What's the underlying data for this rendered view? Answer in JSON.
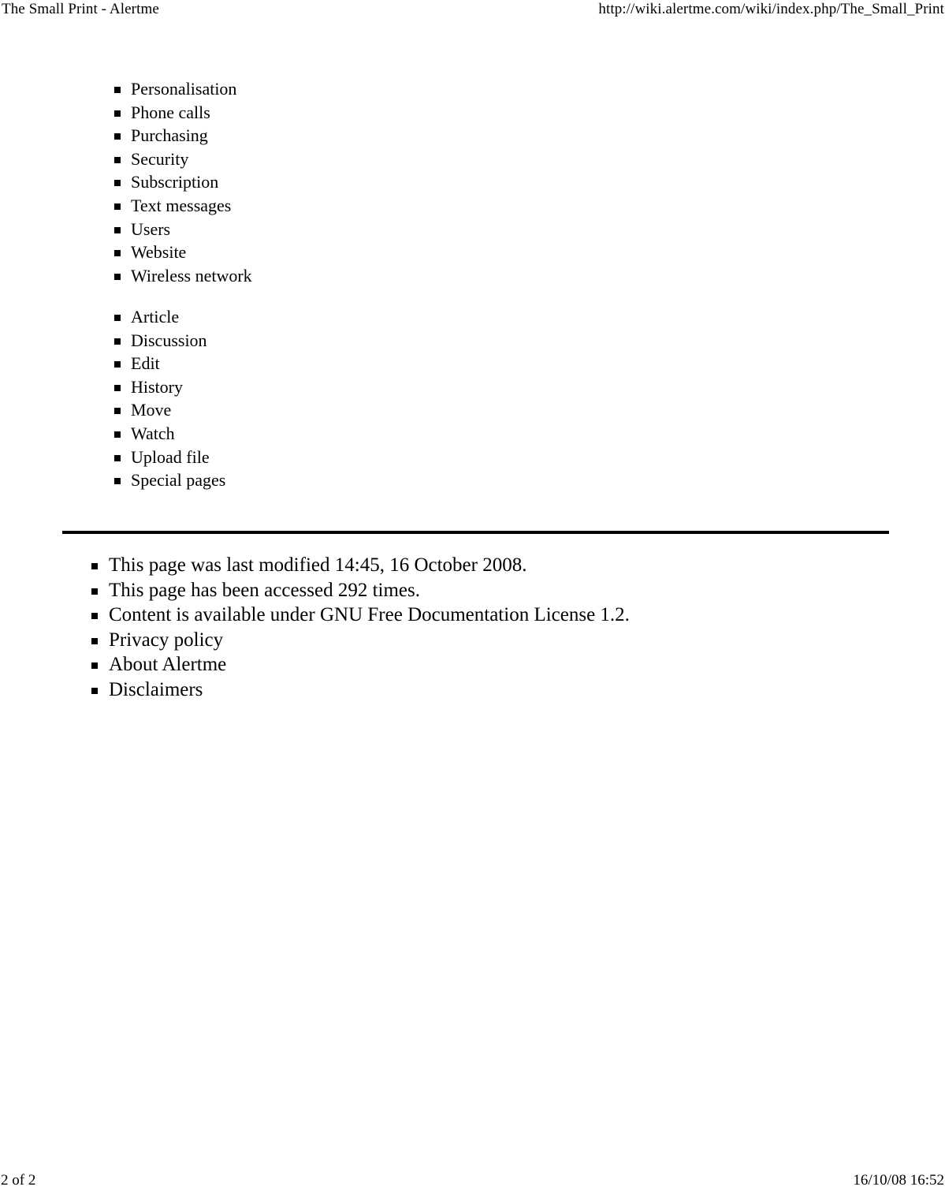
{
  "page_header": {
    "title": "The Small Print - Alertme",
    "url": "http://wiki.alertme.com/wiki/index.php/The_Small_Print"
  },
  "nav_groups": [
    {
      "group_name": "category-links",
      "items": [
        {
          "label": "Personalisation"
        },
        {
          "label": "Phone calls"
        },
        {
          "label": "Purchasing"
        },
        {
          "label": "Security"
        },
        {
          "label": "Subscription"
        },
        {
          "label": "Text messages"
        },
        {
          "label": "Users"
        },
        {
          "label": "Website"
        },
        {
          "label": "Wireless network"
        }
      ]
    },
    {
      "group_name": "page-action-links",
      "items": [
        {
          "label": "Article"
        },
        {
          "label": "Discussion"
        },
        {
          "label": "Edit"
        },
        {
          "label": "History"
        },
        {
          "label": "Move"
        },
        {
          "label": "Watch"
        },
        {
          "label": "Upload file"
        },
        {
          "label": "Special pages"
        }
      ]
    }
  ],
  "wiki_footer": {
    "items": [
      {
        "label": "This page was last modified 14:45, 16 October 2008."
      },
      {
        "label": "This page has been accessed 292 times."
      },
      {
        "label": "Content is available under GNU Free Documentation License 1.2."
      },
      {
        "label": "Privacy policy"
      },
      {
        "label": "About Alertme"
      },
      {
        "label": "Disclaimers"
      }
    ]
  },
  "page_footer": {
    "page_indicator": "2 of 2",
    "timestamp": "16/10/08 16:52"
  },
  "colors": {
    "text": "#000000",
    "background": "#ffffff",
    "rule": "#000000"
  }
}
